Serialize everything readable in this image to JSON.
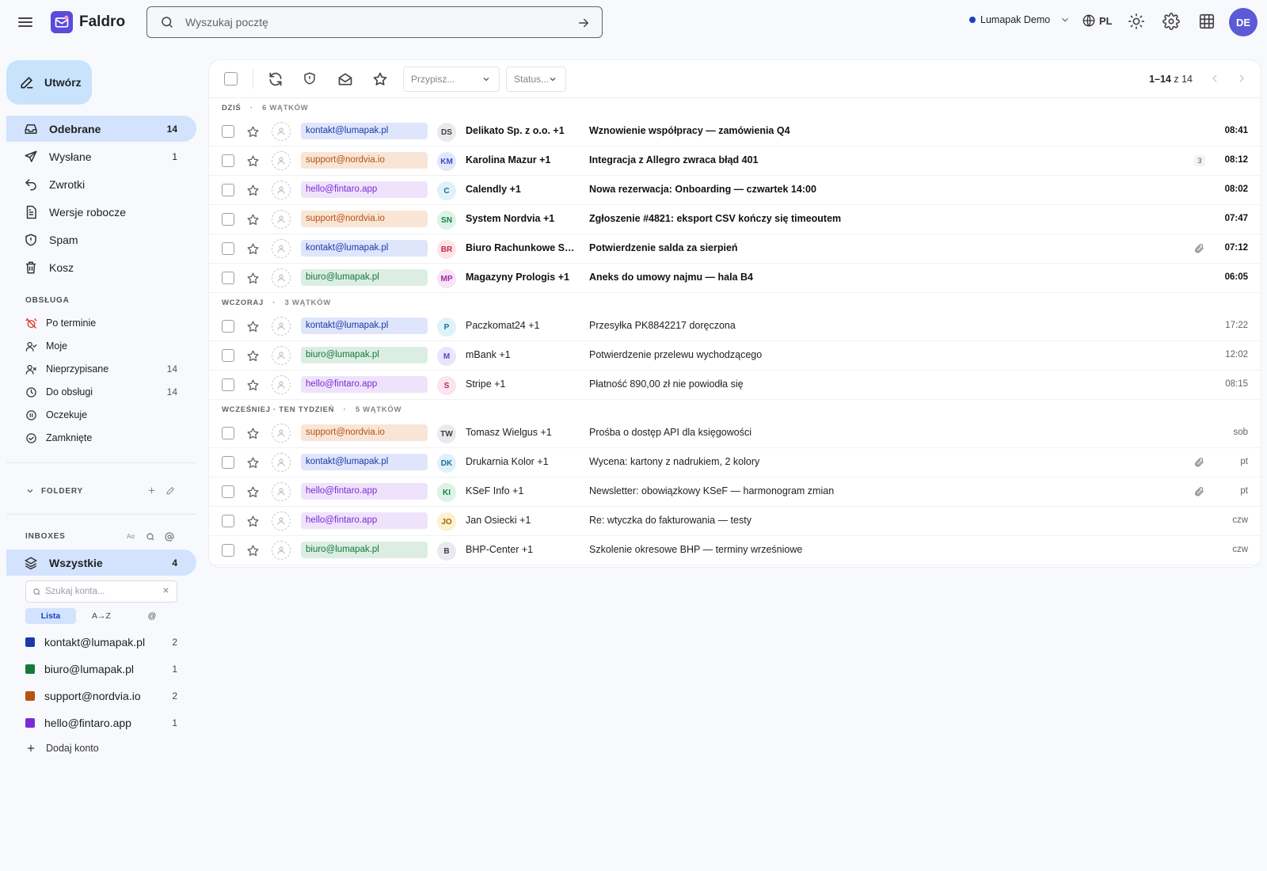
{
  "header": {
    "brand": "Faldro",
    "search_placeholder": "Wyszukaj pocztę",
    "workspace": "Lumapak Demo",
    "language": "PL",
    "avatar_initials": "DE"
  },
  "sidebar": {
    "compose_label": "Utwórz",
    "nav": [
      {
        "label": "Odebrane",
        "count": "14"
      },
      {
        "label": "Wysłane",
        "count": "1"
      },
      {
        "label": "Zwrotki",
        "count": ""
      },
      {
        "label": "Wersje robocze",
        "count": ""
      },
      {
        "label": "Spam",
        "count": ""
      },
      {
        "label": "Kosz",
        "count": ""
      }
    ],
    "service_title": "OBSŁUGA",
    "service": [
      {
        "label": "Po terminie",
        "count": ""
      },
      {
        "label": "Moje",
        "count": ""
      },
      {
        "label": "Nieprzypisane",
        "count": "14"
      },
      {
        "label": "Do obsługi",
        "count": "14"
      },
      {
        "label": "Oczekuje",
        "count": ""
      },
      {
        "label": "Zamknięte",
        "count": ""
      }
    ],
    "folders_title": "FOLDERY",
    "inboxes_title": "INBOXES",
    "all_label": "Wszystkie",
    "all_count": "4",
    "account_search_placeholder": "Szukaj konta...",
    "view_chips": [
      "Lista",
      "A→Z",
      "@"
    ],
    "accounts": [
      {
        "email": "kontakt@lumapak.pl",
        "count": "2",
        "color": "#1b3aa8"
      },
      {
        "email": "biuro@lumapak.pl",
        "count": "1",
        "color": "#127a3a"
      },
      {
        "email": "support@nordvia.io",
        "count": "2",
        "color": "#b7520f"
      },
      {
        "email": "hello@fintaro.app",
        "count": "1",
        "color": "#7b2bd4"
      }
    ],
    "add_account_label": "Dodaj konto"
  },
  "toolbar": {
    "assign_placeholder": "Przypisz...",
    "status_placeholder": "Status...",
    "range": "1–14",
    "of_label": "z 14"
  },
  "groups": [
    {
      "title": "DZIŚ",
      "count_label": "6 WĄTKÓW"
    },
    {
      "title": "WCZORAJ",
      "count_label": "3 WĄTKÓW"
    },
    {
      "title": "WCZEŚNIEJ · TEN TYDZIEŃ",
      "count_label": "5 WĄTKÓW"
    }
  ],
  "messages": [
    {
      "tag": "kontakt@lumapak.pl",
      "tag_style": "blue",
      "initials": "DS",
      "from": "Delikato Sp. z o.o. +1",
      "subject": "Wznowienie współpracy — zamówienia Q4",
      "time": "08:41",
      "unread": true,
      "thread_count": "",
      "attachment": false
    },
    {
      "tag": "support@nordvia.io",
      "tag_style": "orange",
      "initials": "KM",
      "from": "Karolina Mazur +1",
      "subject": "Integracja z Allegro zwraca błąd 401",
      "time": "08:12",
      "unread": true,
      "thread_count": "3",
      "attachment": false
    },
    {
      "tag": "hello@fintaro.app",
      "tag_style": "purple",
      "initials": "C",
      "from": "Calendly +1",
      "subject": "Nowa rezerwacja: Onboarding — czwartek 14:00",
      "time": "08:02",
      "unread": true,
      "thread_count": "",
      "attachment": false
    },
    {
      "tag": "support@nordvia.io",
      "tag_style": "orange",
      "initials": "SN",
      "from": "System Nordvia +1",
      "subject": "Zgłoszenie #4821: eksport CSV kończy się timeoutem",
      "time": "07:47",
      "unread": true,
      "thread_count": "",
      "attachment": false
    },
    {
      "tag": "kontakt@lumapak.pl",
      "tag_style": "blue",
      "initials": "BR",
      "from": "Biuro Rachunkowe Saldo +1",
      "subject": "Potwierdzenie salda za sierpień",
      "time": "07:12",
      "unread": true,
      "thread_count": "",
      "attachment": true
    },
    {
      "tag": "biuro@lumapak.pl",
      "tag_style": "green",
      "initials": "MP",
      "from": "Magazyny Prologis +1",
      "subject": "Aneks do umowy najmu — hala B4",
      "time": "06:05",
      "unread": true,
      "thread_count": "",
      "attachment": false
    },
    {
      "tag": "kontakt@lumapak.pl",
      "tag_style": "blue",
      "initials": "P",
      "from": "Paczkomat24 +1",
      "subject": "Przesyłka PK8842217 doręczona",
      "time": "17:22",
      "unread": false,
      "thread_count": "",
      "attachment": false
    },
    {
      "tag": "biuro@lumapak.pl",
      "tag_style": "green",
      "initials": "M",
      "from": "mBank +1",
      "subject": "Potwierdzenie przelewu wychodzącego",
      "time": "12:02",
      "unread": false,
      "thread_count": "",
      "attachment": false
    },
    {
      "tag": "hello@fintaro.app",
      "tag_style": "purple",
      "initials": "S",
      "from": "Stripe +1",
      "subject": "Płatność 890,00 zł nie powiodła się",
      "time": "08:15",
      "unread": false,
      "thread_count": "",
      "attachment": false
    },
    {
      "tag": "support@nordvia.io",
      "tag_style": "orange",
      "initials": "TW",
      "from": "Tomasz Wielgus +1",
      "subject": "Prośba o dostęp API dla księgowości",
      "time": "sob",
      "unread": false,
      "thread_count": "",
      "attachment": false
    },
    {
      "tag": "kontakt@lumapak.pl",
      "tag_style": "blue",
      "initials": "DK",
      "from": "Drukarnia Kolor +1",
      "subject": "Wycena: kartony z nadrukiem, 2 kolory",
      "time": "pt",
      "unread": false,
      "thread_count": "",
      "attachment": true
    },
    {
      "tag": "hello@fintaro.app",
      "tag_style": "purple",
      "initials": "KI",
      "from": "KSeF Info +1",
      "subject": "Newsletter: obowiązkowy KSeF — harmonogram zmian",
      "time": "pt",
      "unread": false,
      "thread_count": "",
      "attachment": true
    },
    {
      "tag": "hello@fintaro.app",
      "tag_style": "purple",
      "initials": "JO",
      "from": "Jan Osiecki +1",
      "subject": "Re: wtyczka do fakturowania — testy",
      "time": "czw",
      "unread": false,
      "thread_count": "",
      "attachment": false
    },
    {
      "tag": "biuro@lumapak.pl",
      "tag_style": "green",
      "initials": "B",
      "from": "BHP-Center +1",
      "subject": "Szkolenie okresowe BHP — terminy wrześniowe",
      "time": "czw",
      "unread": false,
      "thread_count": "",
      "attachment": false
    }
  ],
  "avatar_colors": [
    {
      "bg": "#e8eaed",
      "fg": "#3c4043"
    },
    {
      "bg": "#e3e7fb",
      "fg": "#3b4cc0"
    },
    {
      "bg": "#dff2fa",
      "fg": "#1a6f9a"
    },
    {
      "bg": "#ddf3e6",
      "fg": "#17804a"
    },
    {
      "bg": "#fde4e7",
      "fg": "#c3284a"
    },
    {
      "bg": "#f8e3f7",
      "fg": "#a52aa0"
    },
    {
      "bg": "#dff2fa",
      "fg": "#1a6f9a"
    },
    {
      "bg": "#e9e6fb",
      "fg": "#5b46c7"
    },
    {
      "bg": "#fbe3ef",
      "fg": "#b8296c"
    },
    {
      "bg": "#e8eaed",
      "fg": "#3c4043"
    },
    {
      "bg": "#dff2fa",
      "fg": "#1a6f9a"
    },
    {
      "bg": "#ddf3e6",
      "fg": "#17804a"
    },
    {
      "bg": "#fdf1cf",
      "fg": "#9a6a00"
    },
    {
      "bg": "#e8eaed",
      "fg": "#3c4043"
    }
  ]
}
